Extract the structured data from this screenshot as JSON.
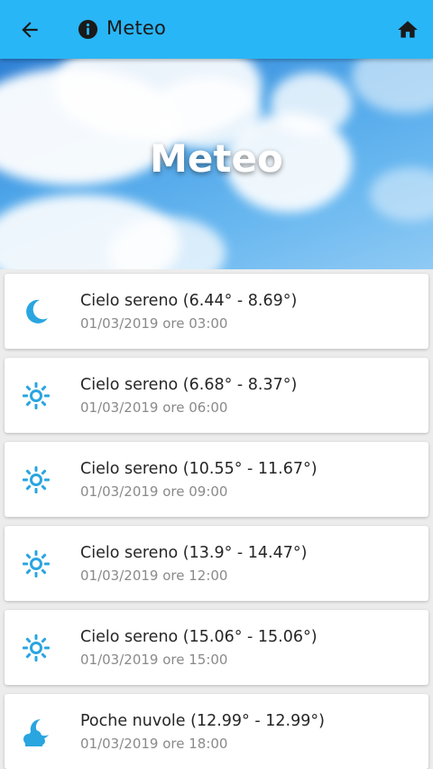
{
  "app_bar": {
    "title": "Meteo",
    "icons": [
      "arrow-back-icon",
      "info-icon",
      "home-icon"
    ]
  },
  "hero": {
    "title": "Meteo"
  },
  "accent_color": "#29b6f6",
  "forecasts": [
    {
      "condition": "Cielo sereno (6.44° - 8.69°)",
      "datetime": "01/03/2019 ore 03:00",
      "icon": "moon-icon"
    },
    {
      "condition": "Cielo sereno (6.68° - 8.37°)",
      "datetime": "01/03/2019 ore 06:00",
      "icon": "sun-icon"
    },
    {
      "condition": "Cielo sereno (10.55° - 11.67°)",
      "datetime": "01/03/2019 ore 09:00",
      "icon": "sun-icon"
    },
    {
      "condition": "Cielo sereno (13.9° - 14.47°)",
      "datetime": "01/03/2019 ore 12:00",
      "icon": "sun-icon"
    },
    {
      "condition": "Cielo sereno (15.06° - 15.06°)",
      "datetime": "01/03/2019 ore 15:00",
      "icon": "sun-icon"
    },
    {
      "condition": "Poche nuvole (12.99° - 12.99°)",
      "datetime": "01/03/2019 ore 18:00",
      "icon": "moon-cloud-icon"
    }
  ]
}
